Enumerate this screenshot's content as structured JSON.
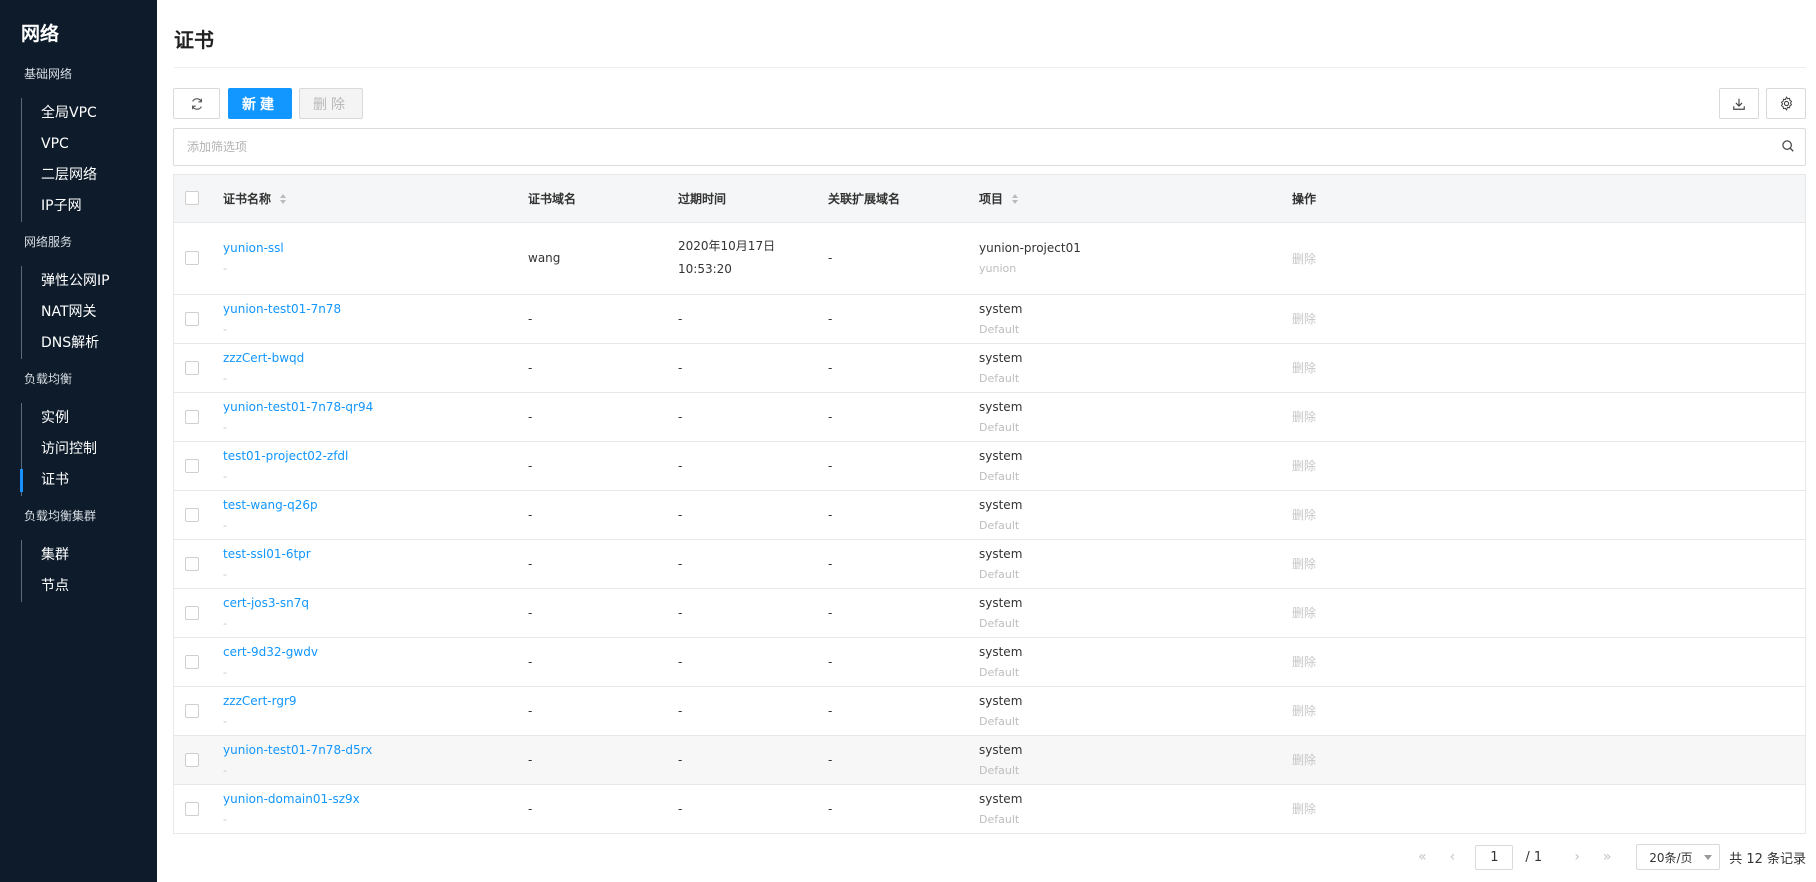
{
  "sidebar": {
    "title": "网络",
    "groups": [
      {
        "title": "基础网络",
        "items": [
          {
            "label": "全局VPC"
          },
          {
            "label": "VPC"
          },
          {
            "label": "二层网络"
          },
          {
            "label": "IP子网"
          }
        ]
      },
      {
        "title": "网络服务",
        "items": [
          {
            "label": "弹性公网IP"
          },
          {
            "label": "NAT网关"
          },
          {
            "label": "DNS解析"
          }
        ]
      },
      {
        "title": "负载均衡",
        "items": [
          {
            "label": "实例"
          },
          {
            "label": "访问控制"
          },
          {
            "label": "证书"
          }
        ]
      },
      {
        "title": "负载均衡集群",
        "items": [
          {
            "label": "集群"
          },
          {
            "label": "节点"
          }
        ]
      }
    ]
  },
  "page": {
    "title": "证书"
  },
  "toolbar": {
    "create_label": "新建",
    "delete_label": "删除"
  },
  "filter": {
    "placeholder": "添加筛选项",
    "value": ""
  },
  "table": {
    "headers": {
      "name": "证书名称",
      "domain": "证书域名",
      "expire": "过期时间",
      "ext": "关联扩展域名",
      "project": "项目",
      "op": "操作"
    },
    "rows": [
      {
        "name": "yunion-ssl",
        "sub": "-",
        "domain": "wang",
        "expire": "2020年10月17日 10:53:20",
        "ext": "-",
        "project": "yunion-project01",
        "domain_name": "yunion",
        "op": "删除"
      },
      {
        "name": "yunion-test01-7n78",
        "sub": "-",
        "domain": "-",
        "expire": "-",
        "ext": "-",
        "project": "system",
        "domain_name": "Default",
        "op": "删除"
      },
      {
        "name": "zzzCert-bwqd",
        "sub": "-",
        "domain": "-",
        "expire": "-",
        "ext": "-",
        "project": "system",
        "domain_name": "Default",
        "op": "删除"
      },
      {
        "name": "yunion-test01-7n78-qr94",
        "sub": "-",
        "domain": "-",
        "expire": "-",
        "ext": "-",
        "project": "system",
        "domain_name": "Default",
        "op": "删除"
      },
      {
        "name": "test01-project02-zfdl",
        "sub": "-",
        "domain": "-",
        "expire": "-",
        "ext": "-",
        "project": "system",
        "domain_name": "Default",
        "op": "删除"
      },
      {
        "name": "test-wang-q26p",
        "sub": "-",
        "domain": "-",
        "expire": "-",
        "ext": "-",
        "project": "system",
        "domain_name": "Default",
        "op": "删除"
      },
      {
        "name": "test-ssl01-6tpr",
        "sub": "-",
        "domain": "-",
        "expire": "-",
        "ext": "-",
        "project": "system",
        "domain_name": "Default",
        "op": "删除"
      },
      {
        "name": "cert-jos3-sn7q",
        "sub": "-",
        "domain": "-",
        "expire": "-",
        "ext": "-",
        "project": "system",
        "domain_name": "Default",
        "op": "删除"
      },
      {
        "name": "cert-9d32-gwdv",
        "sub": "-",
        "domain": "-",
        "expire": "-",
        "ext": "-",
        "project": "system",
        "domain_name": "Default",
        "op": "删除"
      },
      {
        "name": "zzzCert-rgr9",
        "sub": "-",
        "domain": "-",
        "expire": "-",
        "ext": "-",
        "project": "system",
        "domain_name": "Default",
        "op": "删除"
      },
      {
        "name": "yunion-test01-7n78-d5rx",
        "sub": "-",
        "domain": "-",
        "expire": "-",
        "ext": "-",
        "project": "system",
        "domain_name": "Default",
        "op": "删除"
      },
      {
        "name": "yunion-domain01-sz9x",
        "sub": "-",
        "domain": "-",
        "expire": "-",
        "ext": "-",
        "project": "system",
        "domain_name": "Default",
        "op": "删除"
      }
    ]
  },
  "pagination": {
    "current": "1",
    "total_pages": "/ 1",
    "page_size": "20条/页",
    "total": "共 12 条记录"
  }
}
